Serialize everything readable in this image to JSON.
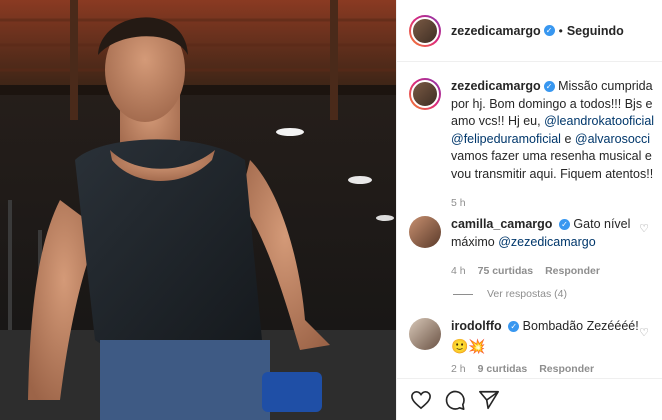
{
  "header": {
    "username": "zezedicamargo",
    "separator": "•",
    "follow_status": "Seguindo"
  },
  "caption": {
    "username": "zezedicamargo",
    "text_1": "Missão cumprida por hj. Bom domingo a todos!!! Bjs e amo vcs!! Hj eu, ",
    "mention_1": "@leandrokatooficial",
    "mention_2": "@felipeduramoficial",
    "text_2": " e ",
    "mention_3": "@alvarosocci",
    "text_3": " vamos fazer uma resenha musical e vou transmitir aqui. Fiquem atentos!!",
    "time": "5 h"
  },
  "comments": [
    {
      "username": "camilla_camargo",
      "text": "Gato nível máximo ",
      "mention": "@zezedicamargo",
      "time": "4 h",
      "likes": "75 curtidas",
      "reply": "Responder"
    },
    {
      "username": "irodolffo",
      "text": "Bombadão Zezéééé!",
      "emoji": "🙂💥",
      "time": "2 h",
      "likes": "9 curtidas",
      "reply": "Responder"
    }
  ],
  "replies_link": "Ver respostas (4)",
  "icons": [
    "heart-icon",
    "comment-icon",
    "share-icon",
    "verified-icon"
  ]
}
